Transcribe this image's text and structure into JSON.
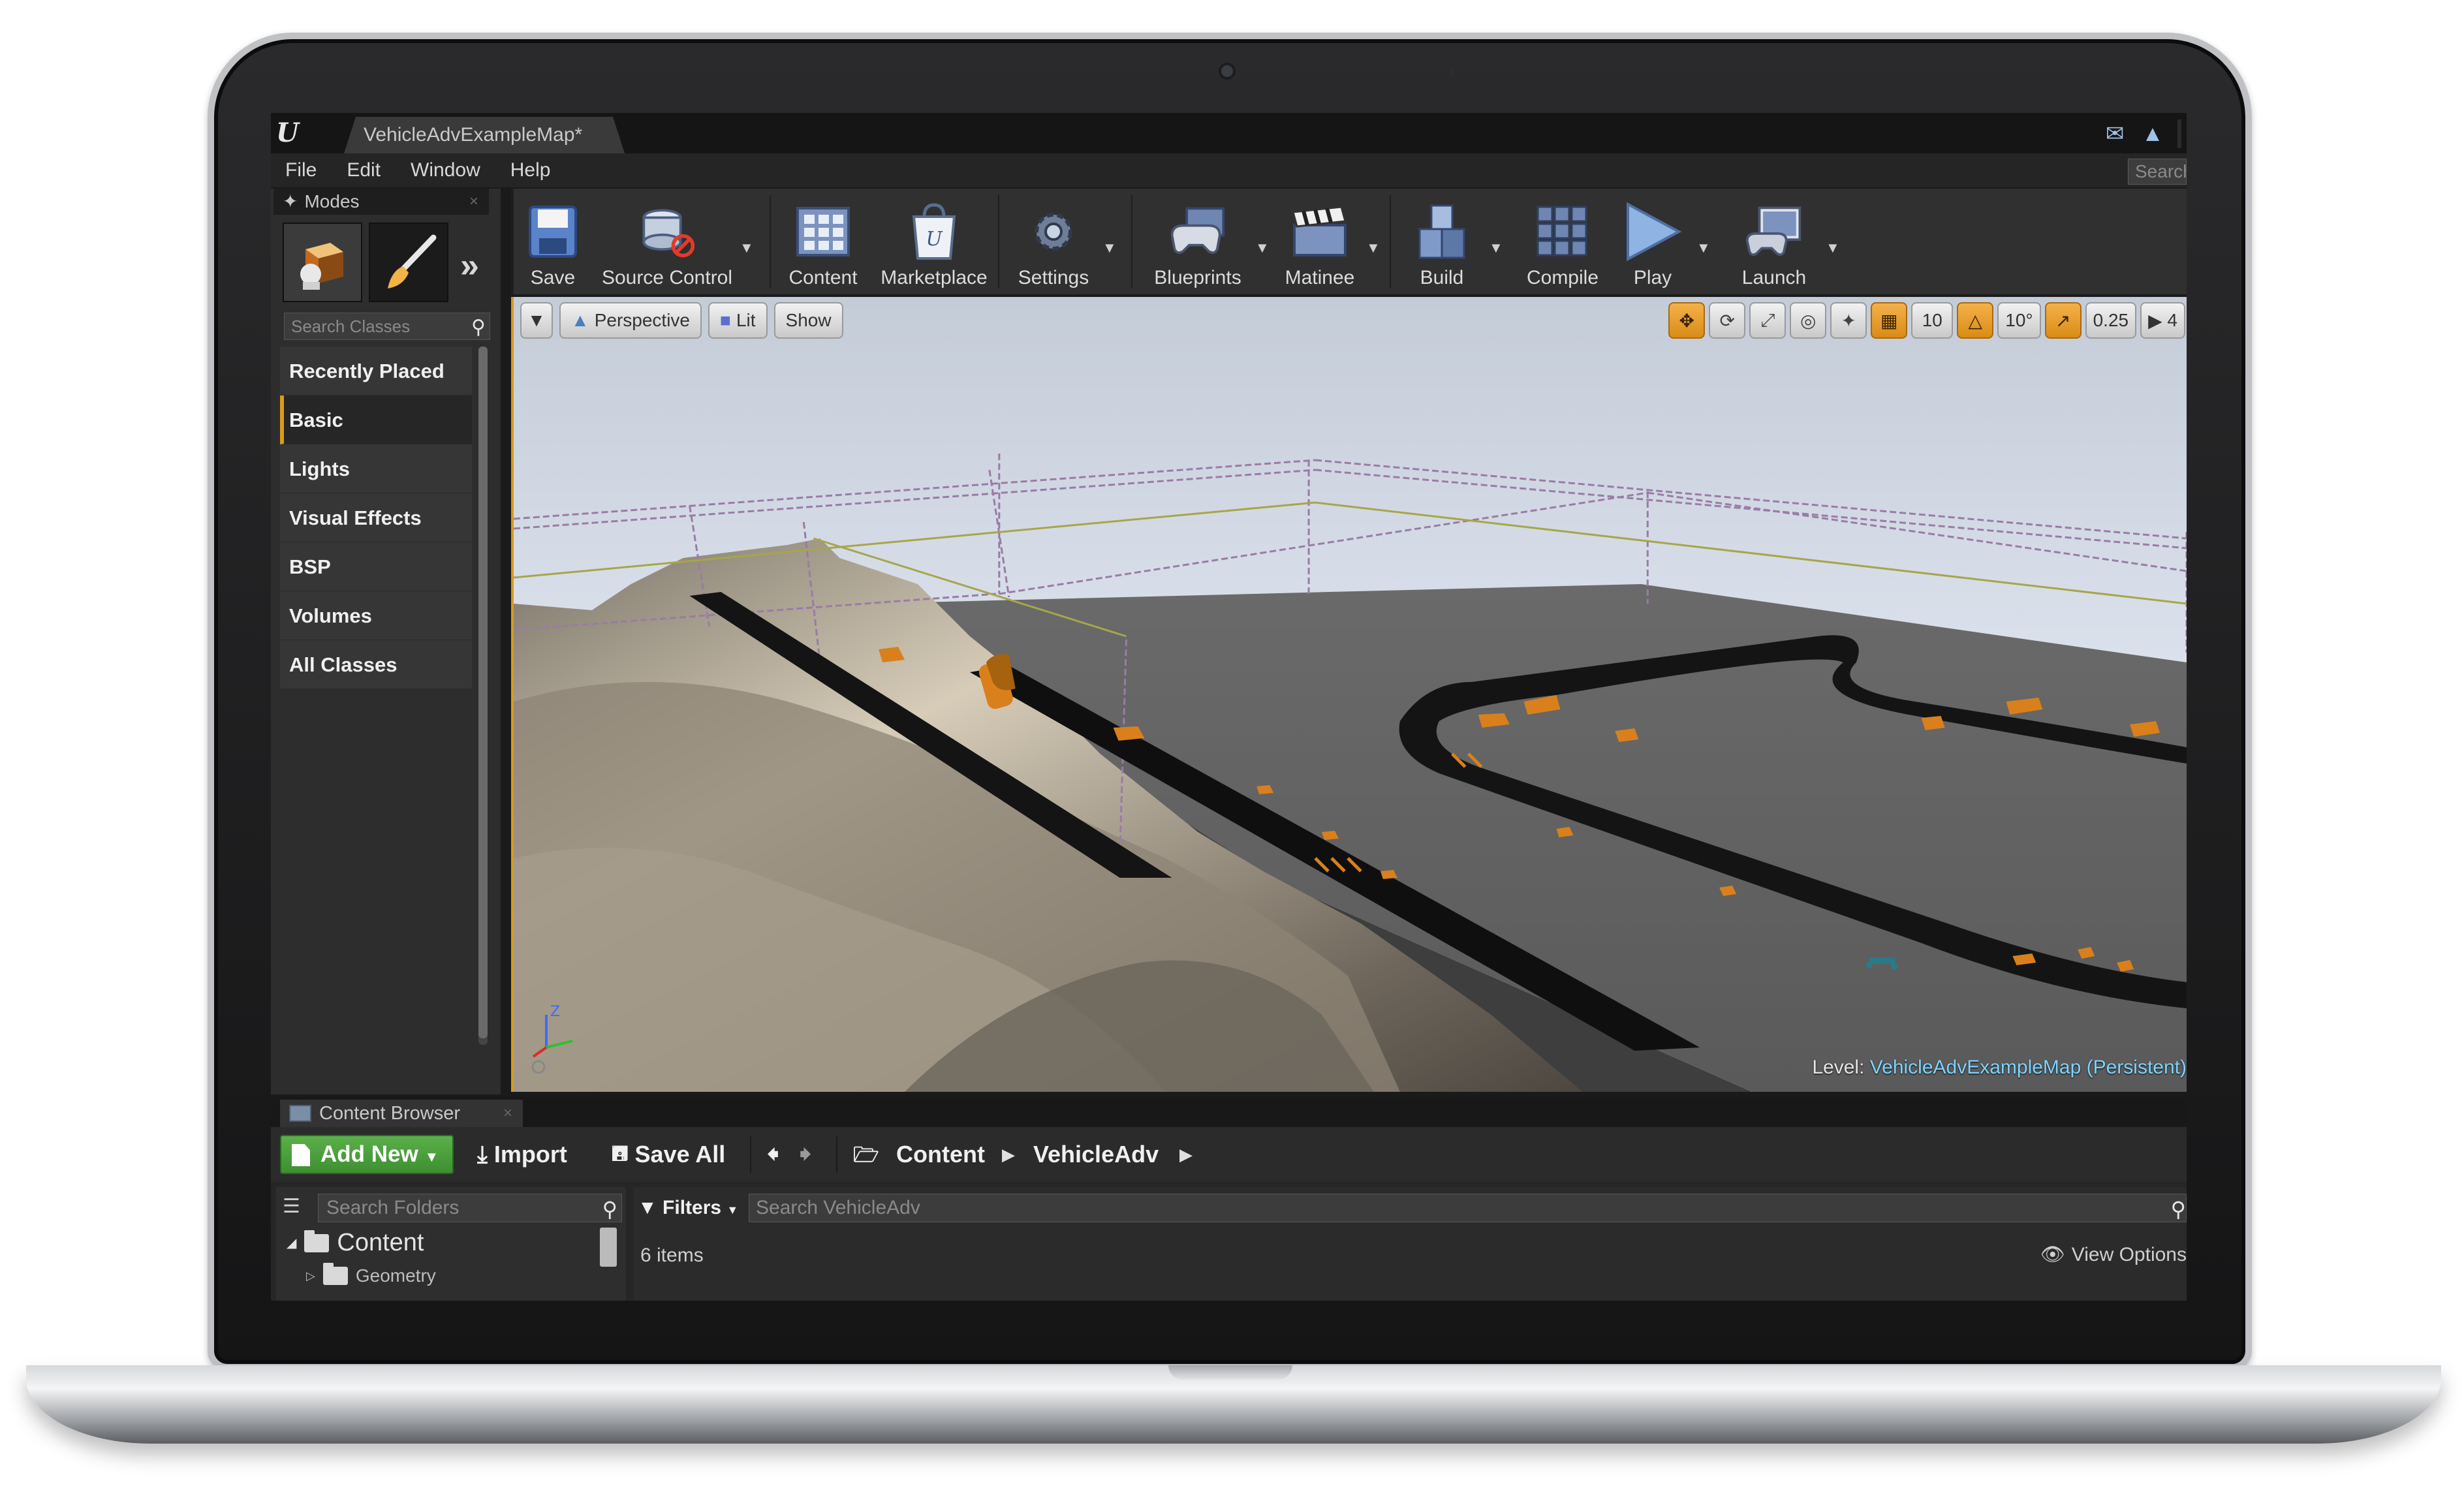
{
  "editor": {
    "document_tab": "VehicleAdvExampleMap*",
    "search_placeholder": "Search"
  },
  "menu": [
    "File",
    "Edit",
    "Window",
    "Help"
  ],
  "modes": {
    "tab_label": "Modes",
    "search_placeholder": "Search Classes",
    "categories": [
      "Recently Placed",
      "Basic",
      "Lights",
      "Visual Effects",
      "BSP",
      "Volumes",
      "All Classes"
    ],
    "active_category": "Basic"
  },
  "toolbar": {
    "save": "Save",
    "source_control": "Source Control",
    "content": "Content",
    "marketplace": "Marketplace",
    "settings": "Settings",
    "blueprints": "Blueprints",
    "matinee": "Matinee",
    "build": "Build",
    "compile": "Compile",
    "play": "Play",
    "launch": "Launch"
  },
  "viewport": {
    "perspective": "Perspective",
    "lit": "Lit",
    "show": "Show",
    "grid_snap": "10",
    "rotation_snap": "10°",
    "scale_snap": "0.25",
    "camera_speed": "4",
    "level_label": "Level:",
    "level_name": "VehicleAdvExampleMap (Persistent)"
  },
  "content_browser": {
    "tab_label": "Content Browser",
    "add_new": "Add New",
    "import": "Import",
    "save_all": "Save All",
    "breadcrumb": [
      "Content",
      "VehicleAdv"
    ],
    "folder_search_placeholder": "Search Folders",
    "filters": "Filters",
    "asset_search_placeholder": "Search VehicleAdv",
    "tree_root": "Content",
    "tree_child": "Geometry",
    "item_count": "6 items",
    "view_options": "View Options"
  },
  "colors": {
    "accent_orange": "#d99a1e",
    "add_new_green": "#4aa03c",
    "level_name_blue": "#7fd4ff"
  }
}
